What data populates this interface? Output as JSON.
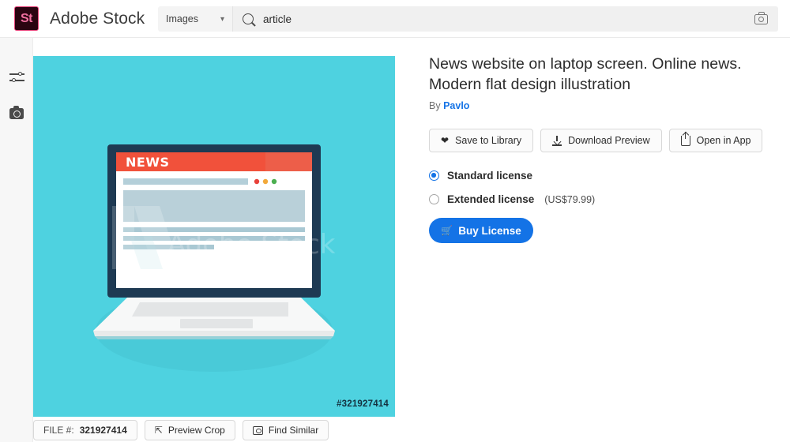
{
  "header": {
    "logo_text": "St",
    "brand": "Adobe Stock",
    "category": "Images",
    "search_value": "article",
    "search_placeholder": "Search",
    "camera_icon": "camera-icon",
    "chevron": "⌄"
  },
  "rail": {
    "filters_icon": "sliders-icon",
    "camera_icon": "camera-icon"
  },
  "image": {
    "file_id_overlay": "#321927414",
    "watermark": "Adobe Stock",
    "news_headline": "NEWS",
    "background_color": "#4ed2e0",
    "bezel_color": "#1e3a53",
    "accent_red": "#f1513b",
    "dot_colors": [
      "#e8413a",
      "#f2a93b",
      "#4caf50"
    ]
  },
  "detail": {
    "title": "News website on laptop screen. Online news. Modern flat design illustration",
    "by_prefix": "By",
    "author": "Pavlo"
  },
  "actions": [
    {
      "label": "Save to Library",
      "icon": "heart-icon"
    },
    {
      "label": "Download Preview",
      "icon": "download-icon"
    },
    {
      "label": "Open in App",
      "icon": "share-icon"
    }
  ],
  "license": {
    "options": [
      {
        "label": "Standard license",
        "price": "",
        "selected": true
      },
      {
        "label": "Extended license",
        "price": "(US$79.99)",
        "selected": false
      }
    ],
    "buy_label": "Buy License",
    "buy_icon": "cart-icon",
    "buy_color": "#1473e6"
  },
  "bottom_bar": [
    {
      "label": "FILE #:",
      "value": "321927414",
      "icon": ""
    },
    {
      "label": "Preview Crop",
      "value": "",
      "icon": "crop-icon"
    },
    {
      "label": "Find Similar",
      "value": "",
      "icon": "similar-icon"
    }
  ]
}
